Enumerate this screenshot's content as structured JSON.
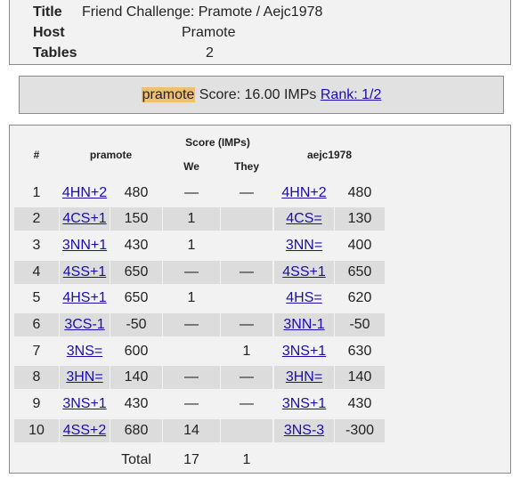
{
  "info": {
    "title_label": "Title",
    "title_value": "Friend Challenge: Pramote / Aejc1978",
    "host_label": "Host",
    "host_value": "Pramote",
    "tables_label": "Tables",
    "tables_value": "2"
  },
  "summary": {
    "player": "pramote",
    "score_text": " Score: 16.00 IMPs ",
    "rank_link": "Rank: 1/2"
  },
  "table": {
    "headers": {
      "number": "#",
      "player1": "pramote",
      "score": "Score (IMPs)",
      "we": "We",
      "they": "They",
      "player2": "aejc1978"
    },
    "rows": [
      {
        "n": "1",
        "c1": "4HN+2",
        "s1": "480",
        "we": "—",
        "they": "—",
        "c2": "4HN+2",
        "s2": "480"
      },
      {
        "n": "2",
        "c1": "4CS+1",
        "s1": "150",
        "we": "1",
        "they": "",
        "c2": "4CS=",
        "s2": "130"
      },
      {
        "n": "3",
        "c1": "3NN+1",
        "s1": "430",
        "we": "1",
        "they": "",
        "c2": "3NN=",
        "s2": "400"
      },
      {
        "n": "4",
        "c1": "4SS+1",
        "s1": "650",
        "we": "—",
        "they": "—",
        "c2": "4SS+1",
        "s2": "650"
      },
      {
        "n": "5",
        "c1": "4HS+1",
        "s1": "650",
        "we": "1",
        "they": "",
        "c2": "4HS=",
        "s2": "620"
      },
      {
        "n": "6",
        "c1": "3CS-1",
        "s1": "-50",
        "we": "—",
        "they": "—",
        "c2": "3NN-1",
        "s2": "-50"
      },
      {
        "n": "7",
        "c1": "3NS=",
        "s1": "600",
        "we": "",
        "they": "1",
        "c2": "3NS+1",
        "s2": "630"
      },
      {
        "n": "8",
        "c1": "3HN=",
        "s1": "140",
        "we": "—",
        "they": "—",
        "c2": "3HN=",
        "s2": "140"
      },
      {
        "n": "9",
        "c1": "3NS+1",
        "s1": "430",
        "we": "—",
        "they": "—",
        "c2": "3NS+1",
        "s2": "430"
      },
      {
        "n": "10",
        "c1": "4SS+2",
        "s1": "680",
        "we": "14",
        "they": "",
        "c2": "3NS-3",
        "s2": "-300"
      }
    ],
    "total": {
      "label": "Total",
      "we": "17",
      "they": "1"
    }
  }
}
